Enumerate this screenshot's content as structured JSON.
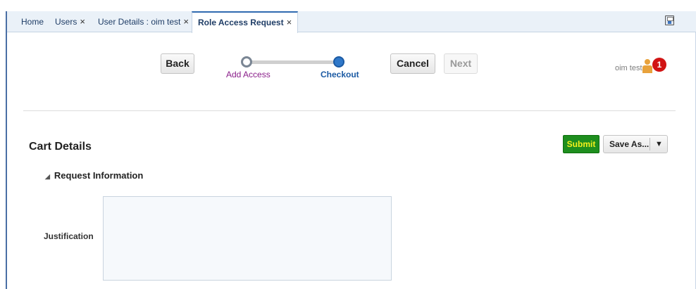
{
  "tabs": [
    {
      "label": "Home",
      "closable": false
    },
    {
      "label": "Users",
      "closable": true
    },
    {
      "label": "User Details : oim test",
      "closable": true
    },
    {
      "label": "Role Access Request",
      "closable": true,
      "active": true
    }
  ],
  "close_glyph": "×",
  "toolbar": {
    "save_icon": "save-disk-icon"
  },
  "wizard": {
    "back_label": "Back",
    "cancel_label": "Cancel",
    "next_label": "Next",
    "steps": [
      {
        "label": "Add Access",
        "state": "visited"
      },
      {
        "label": "Checkout",
        "state": "current"
      }
    ]
  },
  "user": {
    "name": "oim test",
    "notification_count": "1"
  },
  "cart": {
    "title": "Cart Details",
    "submit_label": "Submit",
    "save_as_label": "Save As...",
    "dropdown_glyph": "▼"
  },
  "request_info": {
    "header": "Request Information",
    "collapse_glyph": "◢",
    "justification_label": "Justification",
    "justification_value": ""
  },
  "colors": {
    "submit_bg": "#1e8e1e",
    "submit_text": "#f3f01c",
    "accent_blue": "#2f78c9",
    "visited_step": "#8a1e8a",
    "badge": "#d11414"
  }
}
